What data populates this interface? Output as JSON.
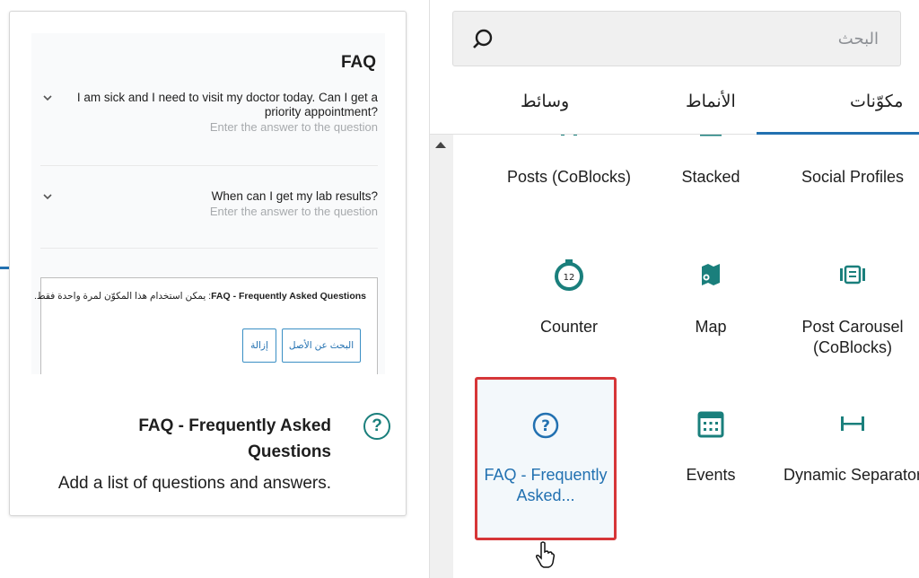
{
  "preview": {
    "faq_heading": "FAQ",
    "items": [
      {
        "question": "I am sick and I need to visit my doctor today. Can I get a priority appointment?",
        "answer_placeholder": "Enter the answer to the question"
      },
      {
        "question": "When can I get my lab results?",
        "answer_placeholder": "Enter the answer to the question"
      }
    ],
    "notice_bold": "FAQ - Frequently Asked Questions",
    "notice_text": ": يمكن استخدام هذا المكوّن لمرة واحدة فقط.",
    "find_original_button": "البحث عن الأصل",
    "remove_button": "إزالة"
  },
  "block_info": {
    "title": "FAQ - Frequently Asked Questions",
    "description": "Add a list of questions and answers."
  },
  "search": {
    "placeholder": "البحث"
  },
  "tabs": [
    {
      "label": "مكوّنات",
      "active": true
    },
    {
      "label": "الأنماط",
      "active": false
    },
    {
      "label": "وسائط",
      "active": false
    }
  ],
  "blocks": [
    {
      "label": "Social Profiles",
      "icon": "social-profiles-icon"
    },
    {
      "label": "Stacked",
      "icon": "stacked-icon"
    },
    {
      "label": "Posts (CoBlocks)",
      "icon": "posts-icon"
    },
    {
      "label": "Post Carousel (CoBlocks)",
      "icon": "post-carousel-icon"
    },
    {
      "label": "Map",
      "icon": "map-icon"
    },
    {
      "label": "Counter",
      "icon": "counter-icon"
    },
    {
      "label": "Dynamic Separator",
      "icon": "dynamic-separator-icon"
    },
    {
      "label": "Events",
      "icon": "events-icon"
    },
    {
      "label": "FAQ - Frequently Asked...",
      "icon": "faq-icon",
      "selected": true
    }
  ],
  "colors": {
    "accent": "#2271b1",
    "icon_teal": "#1a7f7c",
    "highlight_red": "#d63638"
  }
}
